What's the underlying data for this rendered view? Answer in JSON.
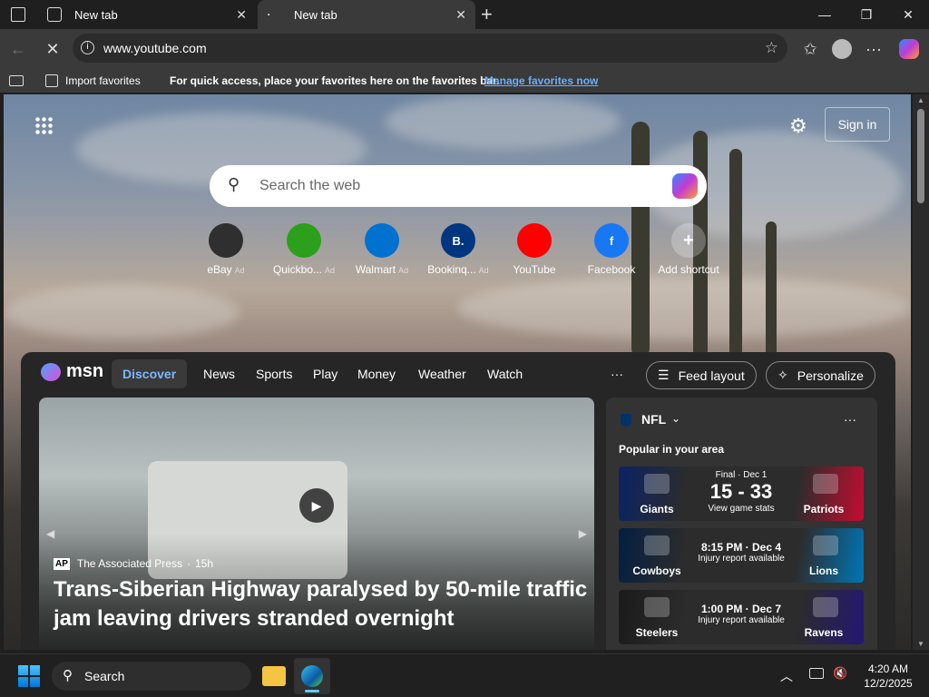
{
  "browser": {
    "tabs": [
      {
        "title": "New tab"
      },
      {
        "title": "New tab"
      }
    ],
    "address": "www.youtube.com",
    "favbar": {
      "import": "Import favorites",
      "hint": "For quick access, place your favorites here on the favorites bar.",
      "manage": "Manage favorites now"
    }
  },
  "newtab": {
    "search_placeholder": "Search the web",
    "signin": "Sign in",
    "shortcuts": [
      {
        "label": "eBay",
        "ad": "Ad",
        "icon": "ebay-icon",
        "color": "#2f2f2f"
      },
      {
        "label": "Quickbo...",
        "ad": "Ad",
        "icon": "quickbooks-icon",
        "color": "#2ca01c"
      },
      {
        "label": "Walmart",
        "ad": "Ad",
        "icon": "walmart-icon",
        "color": "#0071ce"
      },
      {
        "label": "Bookinq...",
        "ad": "Ad",
        "icon": "booking-icon",
        "color": "#003580"
      },
      {
        "label": "YouTube",
        "ad": "",
        "icon": "youtube-icon",
        "color": "#ff0000"
      },
      {
        "label": "Facebook",
        "ad": "",
        "icon": "facebook-icon",
        "color": "#1877f2"
      },
      {
        "label": "Add shortcut",
        "ad": "",
        "icon": "plus-icon",
        "color": "#555"
      }
    ]
  },
  "msn": {
    "logo": "msn",
    "nav": [
      "Discover",
      "News",
      "Sports",
      "Play",
      "Money",
      "Weather",
      "Watch"
    ],
    "more": "···",
    "feed_layout": "Feed layout",
    "personalize": "Personalize",
    "hero": {
      "source": "The Associated Press",
      "age": "15h",
      "headline": "Trans-Siberian Highway paralysed by 50-mile traffic jam leaving drivers stranded overnight"
    },
    "nfl": {
      "title": "NFL",
      "subtitle": "Popular in your area",
      "games": [
        {
          "status": "Final · Dec 1",
          "main": "15 - 33",
          "sub": "View game stats",
          "home": "Giants",
          "away": "Patriots",
          "c1": "#0b2265",
          "c2": "#c60c30"
        },
        {
          "status": "",
          "main": "8:15 PM · Dec 4",
          "sub": "Injury report available",
          "home": "Cowboys",
          "away": "Lions",
          "c1": "#041e42",
          "c2": "#0076b6"
        },
        {
          "status": "",
          "main": "1:00 PM · Dec 7",
          "sub": "Injury report available",
          "home": "Steelers",
          "away": "Ravens",
          "c1": "#1a1a1a",
          "c2": "#241773"
        }
      ]
    }
  },
  "taskbar": {
    "search": "Search",
    "time": "4:20 AM",
    "date": "12/2/2025"
  }
}
